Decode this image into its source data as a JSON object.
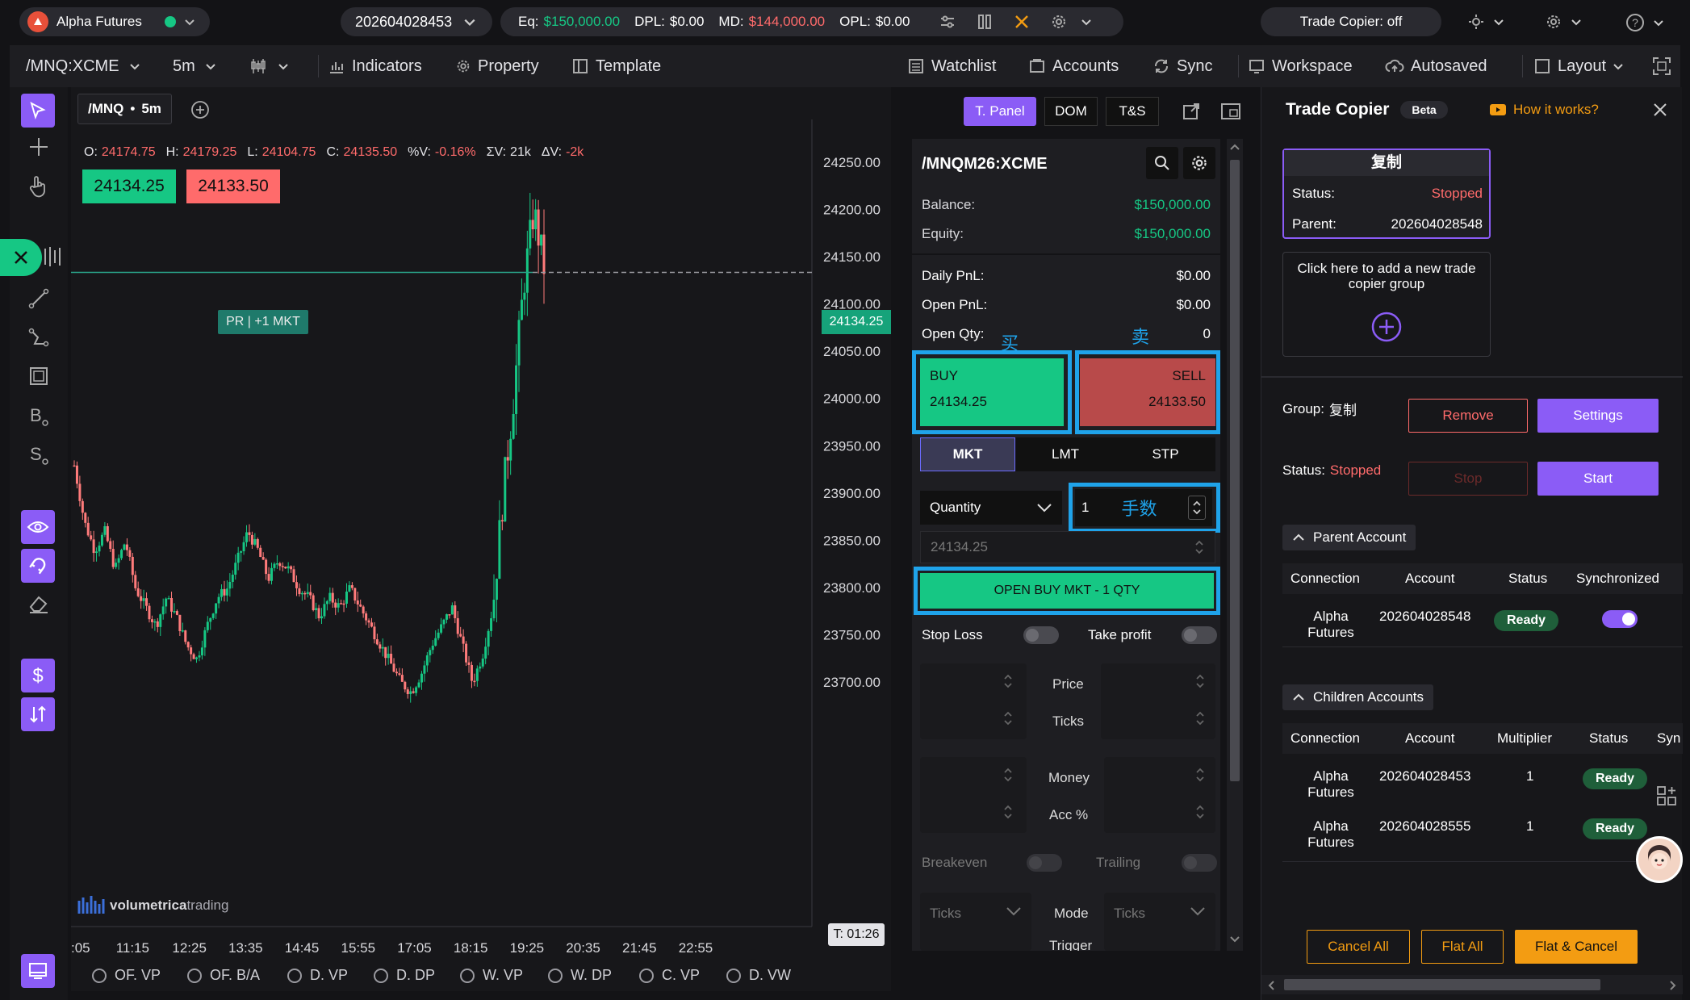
{
  "topbar": {
    "broker": "Alpha Futures",
    "account": "202604028453",
    "eq_label": "Eq:",
    "eq": "$150,000.00",
    "dpl_label": "DPL:",
    "dpl": "$0.00",
    "md_label": "MD:",
    "md": "$144,000.00",
    "opl_label": "OPL:",
    "opl": "$0.00",
    "copier_status": "Trade Copier: off"
  },
  "toolbar": {
    "symbol": "/MNQ:XCME",
    "timeframe": "5m",
    "indicators": "Indicators",
    "property": "Property",
    "template": "Template",
    "watchlist": "Watchlist",
    "accounts": "Accounts",
    "sync": "Sync",
    "workspace": "Workspace",
    "autosaved": "Autosaved",
    "layout": "Layout"
  },
  "chart": {
    "tab_symbol": "/MNQ",
    "tab_tf": "5m",
    "ohlc": {
      "o_label": "O:",
      "o": "24174.75",
      "h_label": "H:",
      "h": "24179.25",
      "l_label": "L:",
      "l": "24104.75",
      "c_label": "C:",
      "c": "24135.50",
      "pct_label": "%V:",
      "pct": "-0.16%",
      "sv_label": "ΣV:",
      "sv": "21k",
      "dv_label": "ΔV:",
      "dv": "-2k"
    },
    "bid_box": "24134.25",
    "ask_box": "24133.50",
    "position_tag": "PR | +1 MKT",
    "current_price": "24134.25",
    "timer": "T: 01:26",
    "watermark_a": "volumetrica",
    "watermark_b": "trading",
    "y_ticks": [
      "24250.00",
      "24200.00",
      "24150.00",
      "24100.00",
      "24050.00",
      "24000.00",
      "23950.00",
      "23900.00",
      "23850.00",
      "23800.00",
      "23750.00",
      "23700.00"
    ],
    "x_ticks": [
      ":05",
      "11:15",
      "12:25",
      "13:35",
      "14:45",
      "15:55",
      "17:05",
      "18:15",
      "19:25",
      "20:35",
      "21:45",
      "22:55"
    ]
  },
  "chart_data": {
    "type": "candlestick",
    "title": "/MNQ:XCME 5m",
    "ylim": [
      23650,
      24280
    ],
    "y_ticks": [
      24250,
      24200,
      24150,
      24100,
      24050,
      24000,
      23950,
      23900,
      23850,
      23800,
      23750,
      23700
    ],
    "x_ticks": [
      ":05",
      "11:15",
      "12:25",
      "13:35",
      "14:45",
      "15:55",
      "17:05",
      "18:15",
      "19:25",
      "20:35",
      "21:45",
      "22:55"
    ],
    "last_price": 24134.25,
    "path_close": [
      23930,
      23870,
      23840,
      23860,
      23820,
      23850,
      23800,
      23780,
      23760,
      23790,
      23770,
      23740,
      23725,
      23760,
      23790,
      23800,
      23830,
      23860,
      23840,
      23810,
      23830,
      23820,
      23800,
      23790,
      23770,
      23790,
      23780,
      23800,
      23780,
      23760,
      23740,
      23720,
      23700,
      23690,
      23710,
      23740,
      23760,
      23780,
      23740,
      23700,
      23730,
      23780,
      23900,
      24000,
      24120,
      24200,
      24140
    ]
  },
  "tpanel": {
    "tabs": [
      "T. Panel",
      "DOM",
      "T&S"
    ],
    "symbol": "/MNQM26:XCME",
    "balance_label": "Balance:",
    "balance": "$150,000.00",
    "equity_label": "Equity:",
    "equity": "$150,000.00",
    "daily_label": "Daily PnL:",
    "daily": "$0.00",
    "open_label": "Open PnL:",
    "open": "$0.00",
    "qty_label": "Open Qty:",
    "qty": "0",
    "ann_buy": "买",
    "ann_sell": "卖",
    "ann_qty": "手数",
    "buy_label": "BUY",
    "buy_price": "24134.25",
    "sell_label": "SELL",
    "sell_price": "24133.50",
    "order_types": [
      "MKT",
      "LMT",
      "STP"
    ],
    "quantity_label": "Quantity",
    "quantity_value": "1",
    "price_value": "24134.25",
    "open_btn": "OPEN BUY MKT - 1 QTY",
    "stop_loss": "Stop Loss",
    "take_profit": "Take profit",
    "price": "Price",
    "ticks": "Ticks",
    "money": "Money",
    "acc": "Acc %",
    "breakeven": "Breakeven",
    "trailing": "Trailing",
    "ticks_sel": "Ticks",
    "mode": "Mode",
    "trigger": "Trigger"
  },
  "indicators_bar": [
    "OF. VP",
    "OF. B/A",
    "D. VP",
    "D. DP",
    "W. VP",
    "W. DP",
    "C. VP",
    "D. VW"
  ],
  "copier": {
    "title": "Trade Copier",
    "beta": "Beta",
    "how": "How it works?",
    "group_name": "复制",
    "status_label": "Status:",
    "status": "Stopped",
    "parent_label": "Parent:",
    "parent": "202604028548",
    "add_text": "Click here to add a new trade copier group",
    "group_label": "Group:",
    "group": "复制",
    "remove": "Remove",
    "settings": "Settings",
    "status2_label": "Status:",
    "status2": "Stopped",
    "stop": "Stop",
    "start": "Start",
    "parent_section": "Parent Account",
    "children_section": "Children Accounts",
    "cols_parent": [
      "Connection",
      "Account",
      "Status",
      "Synchronized"
    ],
    "cols_children": [
      "Connection",
      "Account",
      "Multiplier",
      "Status",
      "Syn"
    ],
    "parent_row": {
      "conn": "Alpha Futures",
      "account": "202604028548",
      "status": "Ready"
    },
    "child_rows": [
      {
        "conn": "Alpha Futures",
        "account": "202604028453",
        "mult": "1",
        "status": "Ready"
      },
      {
        "conn": "Alpha Futures",
        "account": "202604028555",
        "mult": "1",
        "status": "Ready"
      }
    ],
    "cancel_all": "Cancel All",
    "flat_all": "Flat All",
    "flat_cancel": "Flat & Cancel"
  },
  "colors": {
    "green": "#16c784",
    "red": "#ff6b6b",
    "purple": "#8b5cf6",
    "orange": "#f39c12",
    "highlight": "#1fa3ea"
  }
}
